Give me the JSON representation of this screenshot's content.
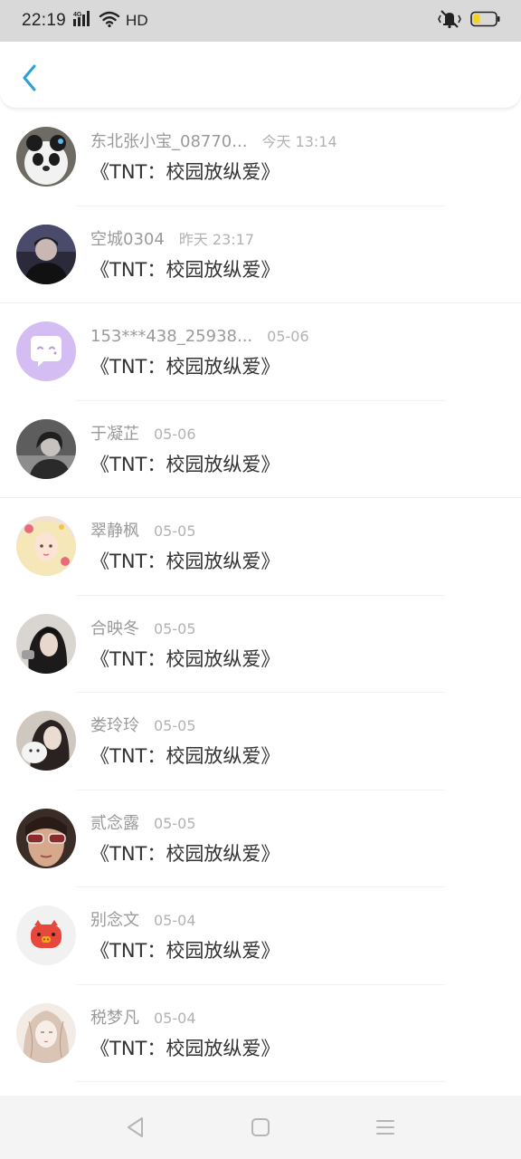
{
  "status_bar": {
    "time": "22:19",
    "network": "4G",
    "hd_label": "HD",
    "icons": [
      "signal-icon",
      "wifi-icon",
      "vibrate-mute-icon",
      "battery-icon"
    ]
  },
  "header": {
    "back_icon": "chevron-left-icon"
  },
  "items": [
    {
      "name": "东北张小宝_08770...",
      "time": "今天 13:14",
      "book": "《TNT：校园放纵爱》",
      "avatar": "plush-bear-avatar"
    },
    {
      "name": "空城0304",
      "time": "昨天 23:17",
      "book": "《TNT：校园放纵爱》",
      "avatar": "person-dark-avatar"
    },
    {
      "name": "153***438_25938...",
      "time": "05-06",
      "book": "《TNT：校园放纵爱》",
      "avatar": "default-chat-avatar"
    },
    {
      "name": "于凝芷",
      "time": "05-06",
      "book": "《TNT：校园放纵爱》",
      "avatar": "person-gray-avatar"
    },
    {
      "name": "翠静枫",
      "time": "05-05",
      "book": "《TNT：校园放纵爱》",
      "avatar": "anime-girl-avatar"
    },
    {
      "name": "合映冬",
      "time": "05-05",
      "book": "《TNT：校园放纵爱》",
      "avatar": "girl-photo-avatar"
    },
    {
      "name": "娄玲玲",
      "time": "05-05",
      "book": "《TNT：校园放纵爱》",
      "avatar": "girl-plush-avatar"
    },
    {
      "name": "贰念露",
      "time": "05-05",
      "book": "《TNT：校园放纵爱》",
      "avatar": "sunglasses-avatar"
    },
    {
      "name": "别念文",
      "time": "05-04",
      "book": "《TNT：校园放纵爱》",
      "avatar": "red-pig-avatar"
    },
    {
      "name": "税梦凡",
      "time": "05-04",
      "book": "《TNT：校园放纵爱》",
      "avatar": "sketch-girl-avatar"
    }
  ],
  "nav_bar": {
    "icons": [
      "back-triangle-icon",
      "home-square-icon",
      "menu-lines-icon"
    ]
  },
  "colors": {
    "accent": "#2a9fd8",
    "status_bar_bg": "#d9d9d9",
    "name_text": "#9a9a9a",
    "time_text": "#b2b2b2",
    "title_text": "#333333",
    "battery_fill": "#f6d21b"
  }
}
